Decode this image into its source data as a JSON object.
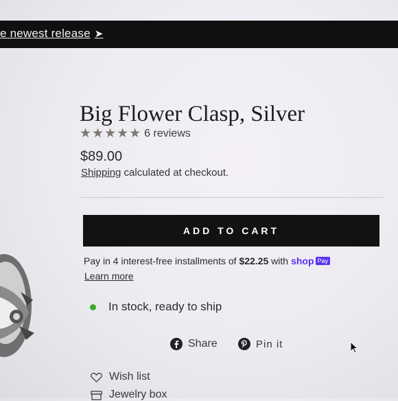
{
  "announcement": {
    "text": "e newest release",
    "arrow": "➤"
  },
  "product": {
    "title": "Big Flower Clasp, Silver",
    "rating": {
      "stars": "★★★★★",
      "value": 5,
      "max": 5,
      "reviews_label": "6 reviews"
    },
    "price": "$89.00",
    "shipping_link": "Shipping",
    "shipping_text": " calculated at checkout."
  },
  "actions": {
    "add_to_cart": "ADD TO CART"
  },
  "installments": {
    "prefix": "Pay in 4 interest-free installments of ",
    "amount": "$22.25",
    "middle": " with",
    "brand": "shop",
    "badge": "Pay",
    "learn_more": "Learn more"
  },
  "stock": {
    "text": "In stock, ready to ship",
    "color": "#3eaa2c"
  },
  "social": {
    "share": "Share",
    "pin": "Pin it"
  },
  "links": {
    "wish_list": "Wish list",
    "jewelry_box": "Jewelry box"
  },
  "icons": [
    "facebook-icon",
    "pinterest-icon",
    "heart-icon",
    "box-icon",
    "star-icon"
  ],
  "colors": {
    "topbar": "#101010",
    "button": "#121212",
    "shop_pay": "#5a31f4",
    "stars": "#7d7a73"
  }
}
